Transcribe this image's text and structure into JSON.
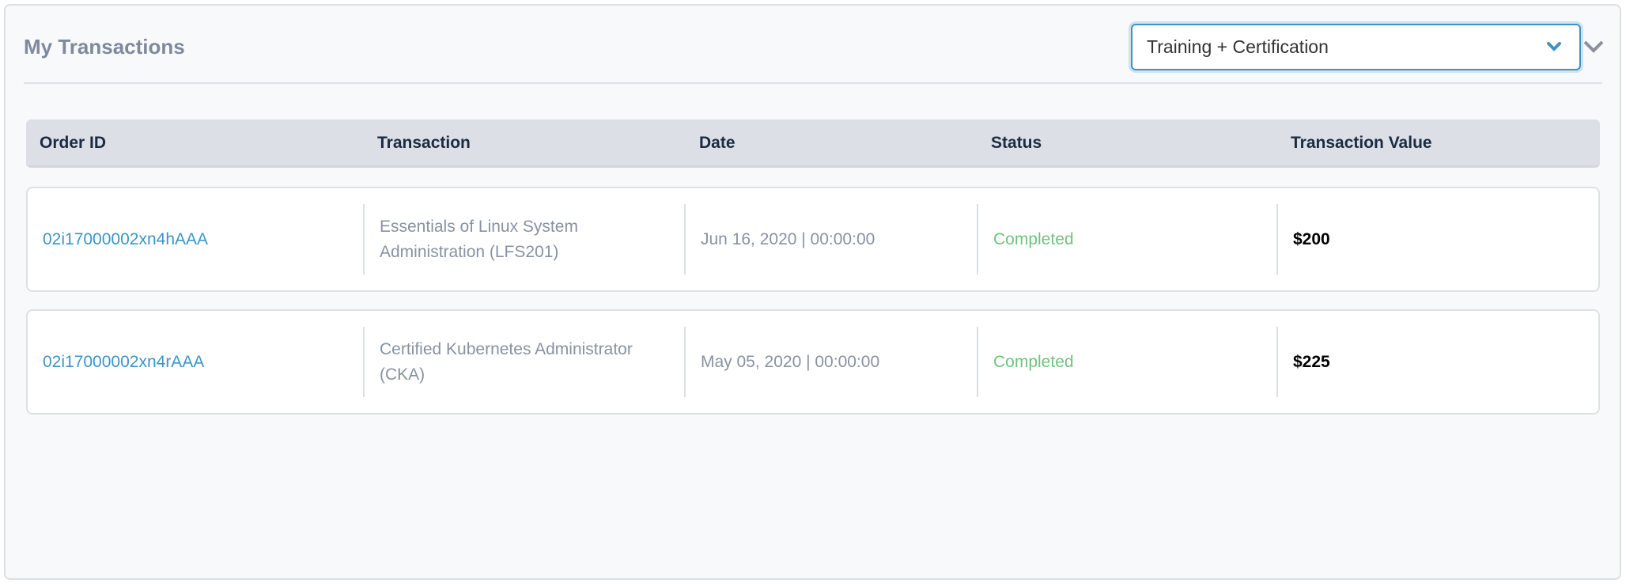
{
  "header": {
    "title": "My Transactions"
  },
  "filter": {
    "selected": "Training + Certification",
    "accent": "#3d93c6"
  },
  "table": {
    "columns": [
      "Order ID",
      "Transaction",
      "Date",
      "Status",
      "Transaction Value"
    ],
    "rows": [
      {
        "order_id": "02i17000002xn4hAAA",
        "transaction": "Essentials of Linux System Administration (LFS201)",
        "date": "Jun 16, 2020 | 00:00:00",
        "status": "Completed",
        "value": "$200"
      },
      {
        "order_id": "02i17000002xn4rAAA",
        "transaction": "Certified Kubernetes Administrator (CKA)",
        "date": "May 05, 2020 | 00:00:00",
        "status": "Completed",
        "value": "$225"
      }
    ]
  }
}
